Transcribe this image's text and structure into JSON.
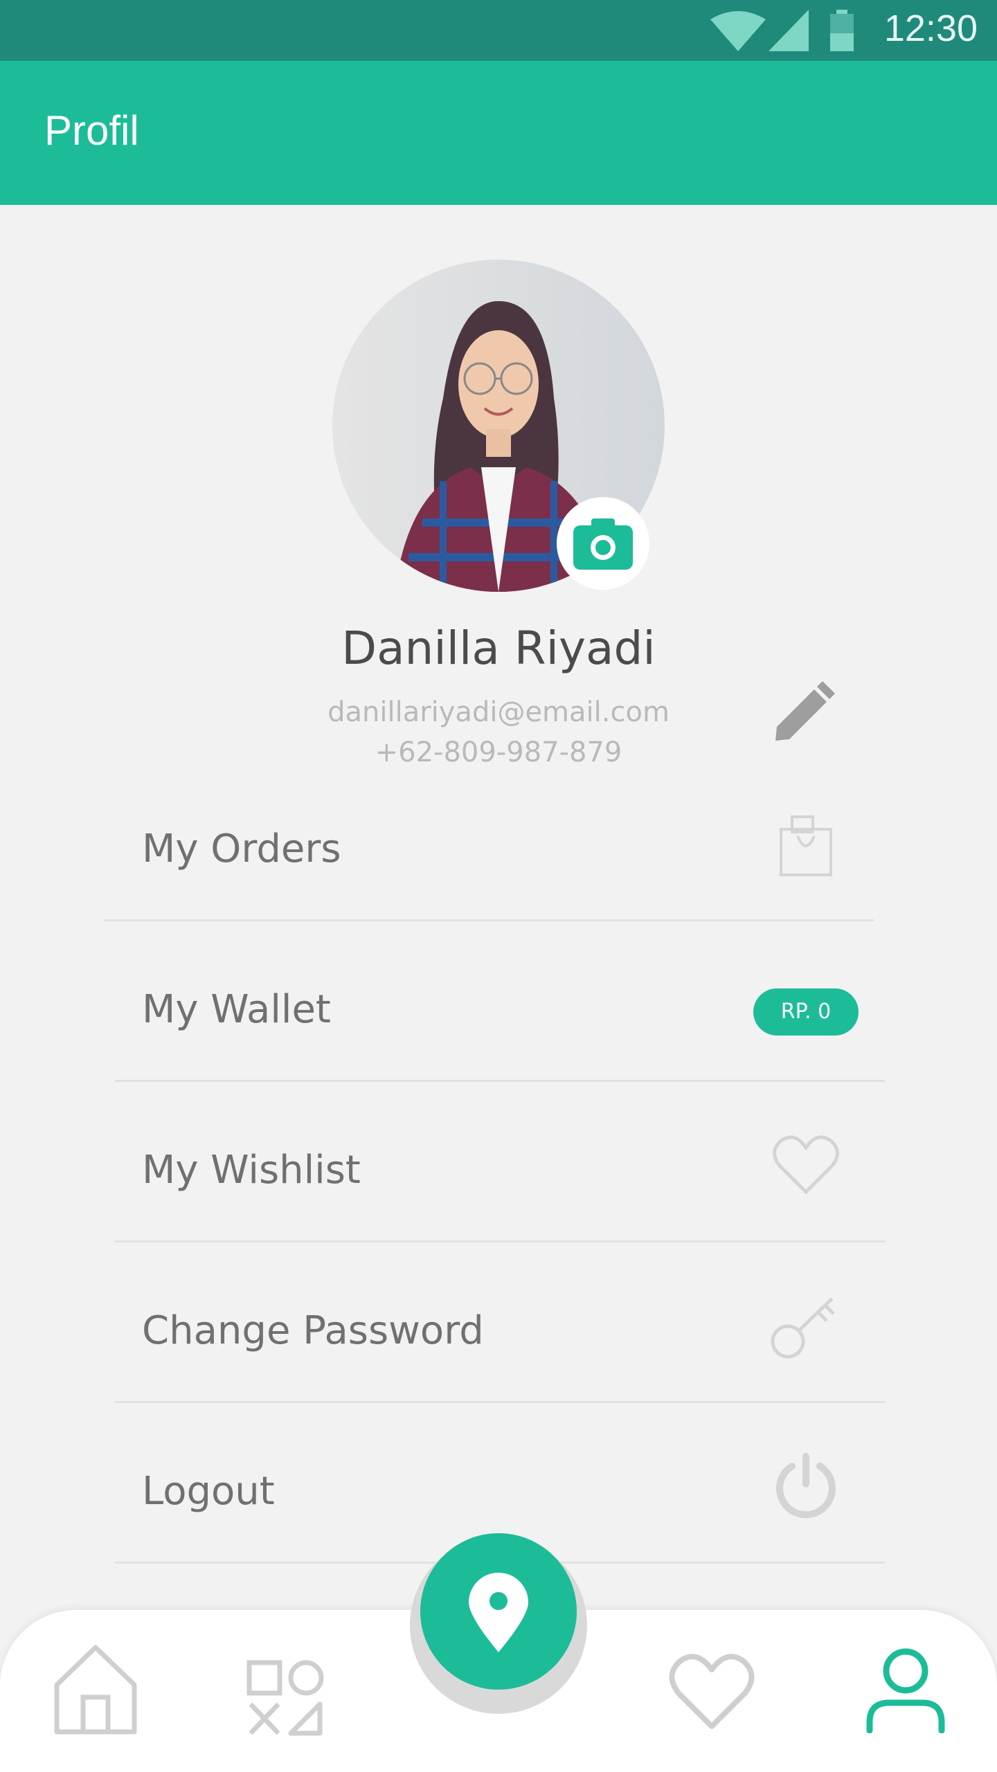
{
  "status_bar": {
    "time": "12:30",
    "icons": [
      "wifi-icon",
      "signal-icon",
      "battery-icon"
    ]
  },
  "app_bar": {
    "title": "Profil"
  },
  "profile": {
    "name": "Danilla Riyadi",
    "email": "danillariyadi@email.com",
    "phone": "+62-809-987-879"
  },
  "menu": [
    {
      "label": "My Orders",
      "icon": "shopping-bag-icon"
    },
    {
      "label": "My Wallet",
      "badge": "RP. 0"
    },
    {
      "label": "My Wishlist",
      "icon": "heart-icon"
    },
    {
      "label": "Change Password",
      "icon": "key-icon"
    },
    {
      "label": "Logout",
      "icon": "power-icon"
    }
  ],
  "bottom_nav": [
    "home-icon",
    "categories-icon",
    "location-pin-icon",
    "heart-icon",
    "profile-icon"
  ],
  "colors": {
    "accent": "#1dbc98",
    "status_bar": "#1f8a7a",
    "background": "#f2f2f2"
  }
}
